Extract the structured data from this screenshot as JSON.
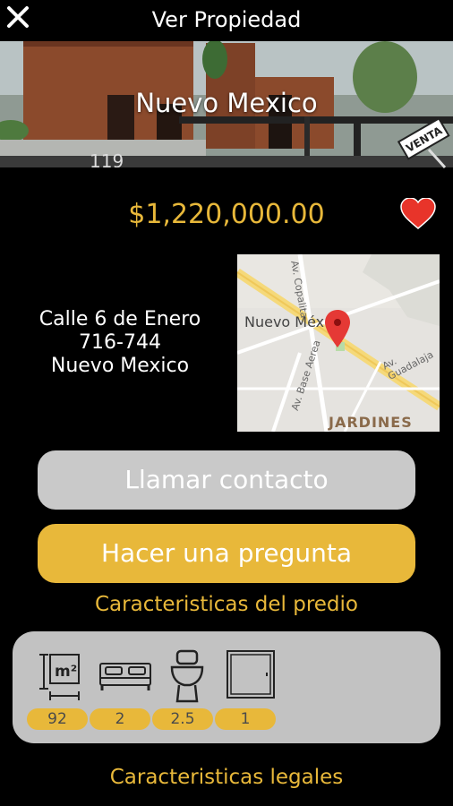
{
  "header": {
    "title": "Ver Propiedad"
  },
  "property": {
    "name": "Nuevo Mexico",
    "sign_label": "VENTA",
    "price": "$1,220,000.00",
    "address_line1": "Calle 6 de Enero",
    "address_line2": "716-744",
    "address_line3": "Nuevo Mexico"
  },
  "map": {
    "label_area": "Nuevo Méx",
    "label_district": "JARDINES",
    "road_1": "Av. Copalita",
    "road_2": "Av. Guadalaja",
    "road_3": "Av. Base Aerea"
  },
  "actions": {
    "call_label": "Llamar contacto",
    "ask_label": "Hacer una pregunta"
  },
  "sections": {
    "predio_title": "Caracteristicas del predio",
    "legal_title": "Caracteristicas legales"
  },
  "features": [
    {
      "icon": "area-m2-icon",
      "value": "92"
    },
    {
      "icon": "bed-icon",
      "value": "2"
    },
    {
      "icon": "toilet-icon",
      "value": "2.5"
    },
    {
      "icon": "door-icon",
      "value": "1"
    }
  ],
  "colors": {
    "accent": "#e8b83a",
    "button_grey": "#c9c9c9",
    "panel_grey": "#c2c2c2",
    "heart": "#e8342a"
  }
}
